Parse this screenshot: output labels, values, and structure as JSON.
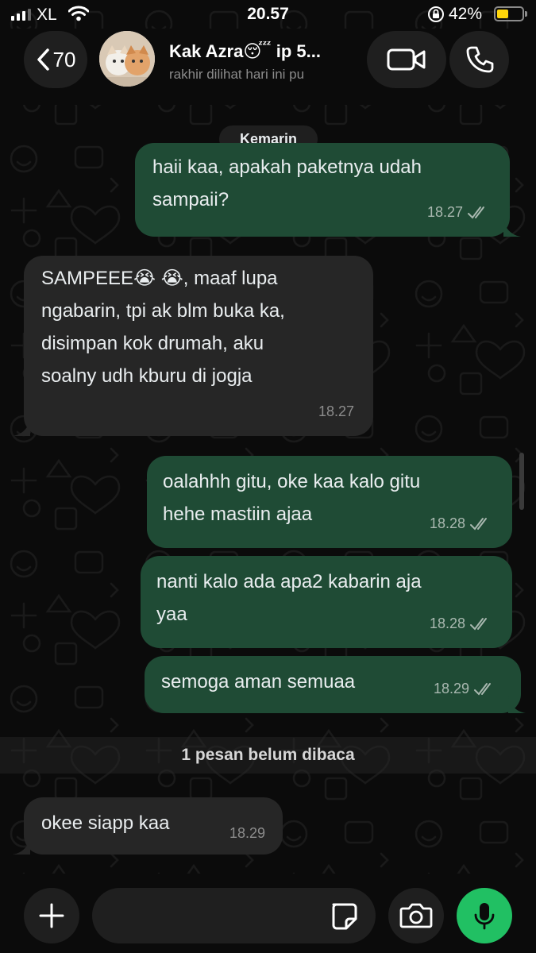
{
  "status_bar": {
    "carrier": "XL",
    "time": "20.57",
    "battery_percent": "42%",
    "battery_level": 0.42,
    "battery_color": "#ffd60a"
  },
  "header": {
    "back_count": "70",
    "contact_name": "Kak Azra😴 ip 5...",
    "last_seen": "rakhir dilihat hari ini pu",
    "icons": [
      "chevron-left-icon",
      "video-camera-icon",
      "phone-icon"
    ]
  },
  "chat": {
    "date_label": "Kemarin",
    "messages": [
      {
        "direction": "out",
        "lines": [
          "haii kaa, apakah paketnya udah",
          "sampaii?"
        ],
        "time": "18.27",
        "ticks": "read"
      },
      {
        "direction": "in",
        "lines": [
          "SAMPEEE😭 😭, maaf lupa",
          "ngabarin, tpi ak blm buka ka,",
          "disimpan kok drumah, aku",
          "soalny udh kburu di jogja"
        ],
        "time": "18.27"
      },
      {
        "direction": "out",
        "lines": [
          "oalahhh gitu, oke kaa kalo gitu",
          "hehe mastiin ajaa"
        ],
        "time": "18.28",
        "ticks": "read"
      },
      {
        "direction": "out",
        "lines": [
          "nanti kalo ada apa2 kabarin aja",
          "yaa"
        ],
        "time": "18.28",
        "ticks": "read"
      },
      {
        "direction": "out",
        "lines": [
          "semoga aman semuaa"
        ],
        "time": "18.29",
        "ticks": "read"
      },
      {
        "direction": "in",
        "lines": [
          "okee siapp kaa"
        ],
        "time": "18.29"
      }
    ],
    "unread_label": "1 pesan belum dibaca"
  },
  "input_bar": {
    "placeholder": "",
    "icons": [
      "plus-icon",
      "sticker-icon",
      "camera-icon",
      "microphone-icon"
    ],
    "mic_color": "#21c063"
  },
  "colors": {
    "outgoing_bubble": "#1f4b35",
    "incoming_bubble": "#262626",
    "background": "#0b0b0b"
  }
}
